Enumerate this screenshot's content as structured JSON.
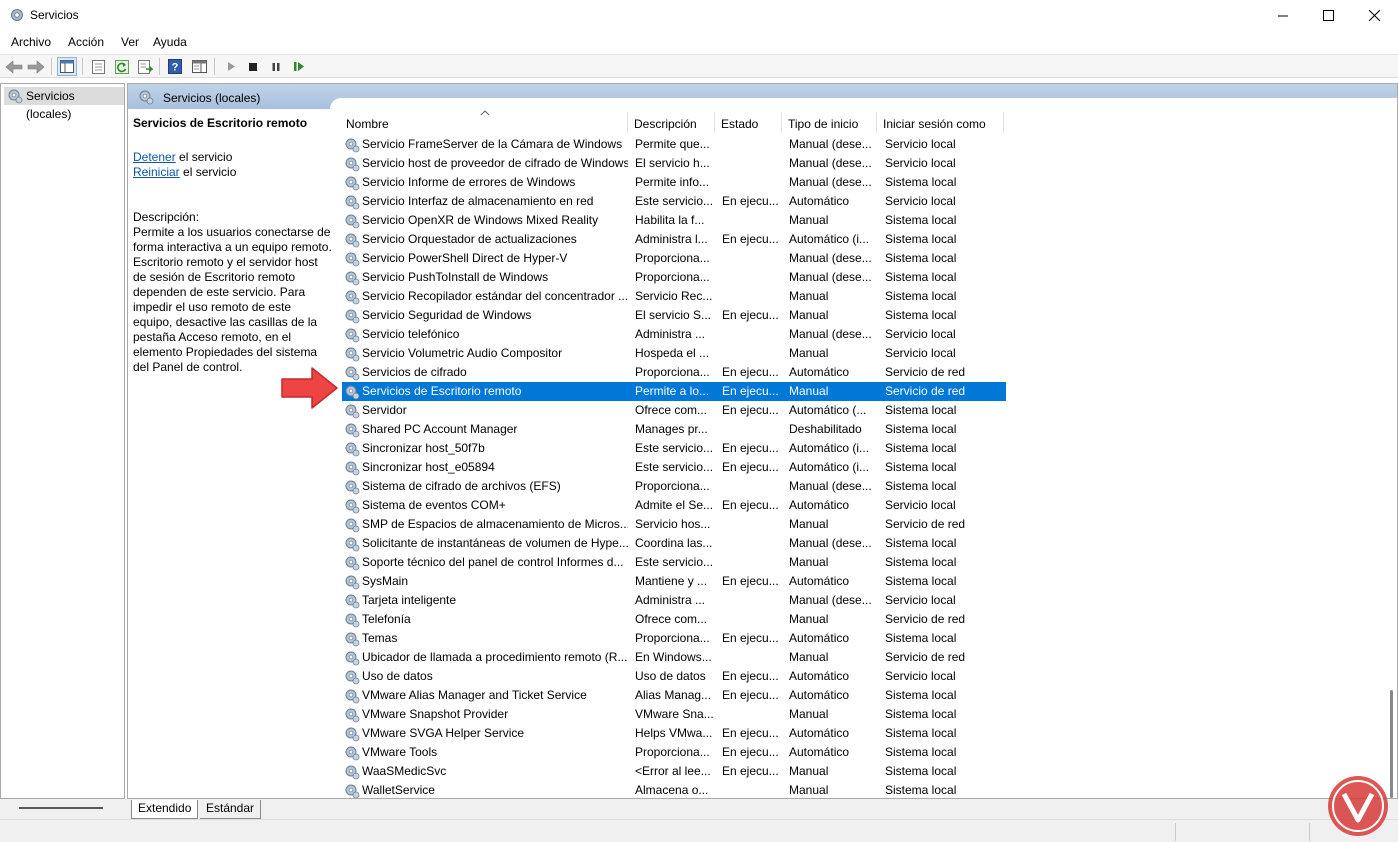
{
  "window": {
    "title": "Servicios"
  },
  "menu": [
    "Archivo",
    "Acción",
    "Ver",
    "Ayuda"
  ],
  "toolbar_icons": [
    "back-arrow-icon",
    "forward-arrow-icon",
    "show-hide-console-tree-icon",
    "properties-icon",
    "refresh-icon",
    "export-list-icon",
    "help-icon",
    "show-hide-action-pane-icon",
    "start-service-icon",
    "stop-service-icon",
    "pause-service-icon",
    "restart-service-icon"
  ],
  "tree": {
    "root_label": "Servicios (locales)"
  },
  "pane_header": {
    "title": "Servicios (locales)"
  },
  "details": {
    "title": "Servicios de Escritorio remoto",
    "stop_link": "Detener",
    "stop_suffix": " el servicio",
    "restart_link": "Reiniciar",
    "restart_suffix": " el servicio",
    "description_label": "Descripción:",
    "description": "Permite a los usuarios conectarse de forma interactiva a un equipo remoto. Escritorio remoto y el servidor host de sesión de Escritorio remoto dependen de este servicio. Para impedir el uso remoto de este equipo, desactive las casillas de la pestaña Acceso remoto, en el elemento Propiedades del sistema del Panel de control."
  },
  "columns": [
    "Nombre",
    "Descripción",
    "Estado",
    "Tipo de inicio",
    "Iniciar sesión como"
  ],
  "rows": [
    [
      "Servicio FrameServer de la Cámara de Windows",
      "Permite que...",
      "",
      "Manual (dese...",
      "Servicio local"
    ],
    [
      "Servicio host de proveedor de cifrado de Windows",
      "El servicio h...",
      "",
      "Manual (dese...",
      "Servicio local"
    ],
    [
      "Servicio Informe de errores de Windows",
      "Permite info...",
      "",
      "Manual (dese...",
      "Sistema local"
    ],
    [
      "Servicio Interfaz de almacenamiento en red",
      "Este servicio...",
      "En ejecu...",
      "Automático",
      "Servicio local"
    ],
    [
      "Servicio OpenXR de Windows Mixed Reality",
      "Habilita la f...",
      "",
      "Manual",
      "Sistema local"
    ],
    [
      "Servicio Orquestador de actualizaciones",
      "Administra l...",
      "En ejecu...",
      "Automático (i...",
      "Sistema local"
    ],
    [
      "Servicio PowerShell Direct de Hyper-V",
      "Proporciona...",
      "",
      "Manual (dese...",
      "Sistema local"
    ],
    [
      "Servicio PushToInstall de Windows",
      "Proporciona...",
      "",
      "Manual (dese...",
      "Sistema local"
    ],
    [
      "Servicio Recopilador estándar del concentrador ...",
      "Servicio Rec...",
      "",
      "Manual",
      "Sistema local"
    ],
    [
      "Servicio Seguridad de Windows",
      "El servicio S...",
      "En ejecu...",
      "Manual",
      "Sistema local"
    ],
    [
      "Servicio telefónico",
      "Administra ...",
      "",
      "Manual (dese...",
      "Servicio local"
    ],
    [
      "Servicio Volumetric Audio Compositor",
      "Hospeda el ...",
      "",
      "Manual",
      "Servicio local"
    ],
    [
      "Servicios de cifrado",
      "Proporciona...",
      "En ejecu...",
      "Automático",
      "Servicio de red"
    ],
    [
      "Servicios de Escritorio remoto",
      "Permite a lo...",
      "En ejecu...",
      "Manual",
      "Servicio de red"
    ],
    [
      "Servidor",
      "Ofrece com...",
      "En ejecu...",
      "Automático (...",
      "Sistema local"
    ],
    [
      "Shared PC Account Manager",
      "Manages pr...",
      "",
      "Deshabilitado",
      "Sistema local"
    ],
    [
      "Sincronizar host_50f7b",
      "Este servicio...",
      "En ejecu...",
      "Automático (i...",
      "Sistema local"
    ],
    [
      "Sincronizar host_e05894",
      "Este servicio...",
      "En ejecu...",
      "Automático (i...",
      "Sistema local"
    ],
    [
      "Sistema de cifrado de archivos (EFS)",
      "Proporciona...",
      "",
      "Manual (dese...",
      "Sistema local"
    ],
    [
      "Sistema de eventos COM+",
      "Admite el Se...",
      "En ejecu...",
      "Automático",
      "Servicio local"
    ],
    [
      "SMP de Espacios de almacenamiento de Micros...",
      "Servicio hos...",
      "",
      "Manual",
      "Servicio de red"
    ],
    [
      "Solicitante de instantáneas de volumen de Hype...",
      "Coordina las...",
      "",
      "Manual (dese...",
      "Sistema local"
    ],
    [
      "Soporte técnico del panel de control Informes d...",
      "Este servicio...",
      "",
      "Manual",
      "Sistema local"
    ],
    [
      "SysMain",
      "Mantiene y ...",
      "En ejecu...",
      "Automático",
      "Sistema local"
    ],
    [
      "Tarjeta inteligente",
      "Administra ...",
      "",
      "Manual (dese...",
      "Servicio local"
    ],
    [
      "Telefonía",
      "Ofrece com...",
      "",
      "Manual",
      "Servicio de red"
    ],
    [
      "Temas",
      "Proporciona...",
      "En ejecu...",
      "Automático",
      "Sistema local"
    ],
    [
      "Ubicador de llamada a procedimiento remoto (R...",
      "En Windows...",
      "",
      "Manual",
      "Servicio de red"
    ],
    [
      "Uso de datos",
      "Uso de datos",
      "En ejecu...",
      "Automático",
      "Servicio local"
    ],
    [
      "VMware Alias Manager and Ticket Service",
      "Alias Manag...",
      "En ejecu...",
      "Automático",
      "Sistema local"
    ],
    [
      "VMware Snapshot Provider",
      "VMware Sna...",
      "",
      "Manual",
      "Sistema local"
    ],
    [
      "VMware SVGA Helper Service",
      "Helps VMwa...",
      "En ejecu...",
      "Automático",
      "Sistema local"
    ],
    [
      "VMware Tools",
      "Proporciona...",
      "En ejecu...",
      "Automático",
      "Sistema local"
    ],
    [
      "WaaSMedicSvc",
      "<Error al lee...",
      "En ejecu...",
      "Manual",
      "Sistema local"
    ],
    [
      "WalletService",
      "Almacena o...",
      "",
      "Manual",
      "Sistema local"
    ]
  ],
  "selected_row_index": 13,
  "bottom_tabs": [
    "Extendido",
    "Estándar"
  ],
  "colors": {
    "selection": "#0078d7",
    "pane_header": "#b4c9e2",
    "link": "#0b57a5",
    "annotation_arrow": "#ee4444"
  }
}
